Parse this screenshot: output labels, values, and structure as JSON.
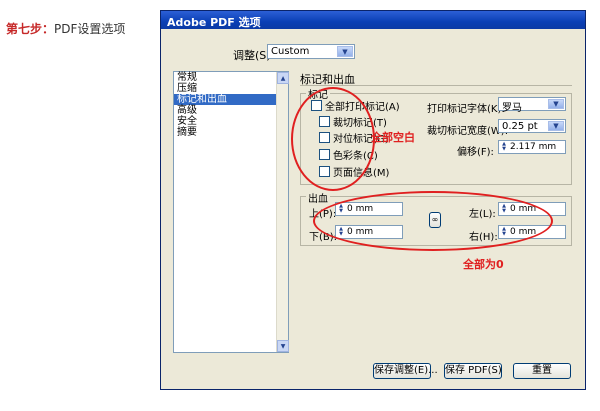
{
  "caption": {
    "step": "第七步：",
    "text": "PDF设置选项"
  },
  "window": {
    "title": "Adobe PDF 选项"
  },
  "preset": {
    "label": "调整(S):",
    "value": "Custom"
  },
  "sidebar": {
    "items": [
      {
        "label": "常规"
      },
      {
        "label": "压缩"
      },
      {
        "label": "标记和出血"
      },
      {
        "label": "高级"
      },
      {
        "label": "安全"
      },
      {
        "label": "摘要"
      }
    ]
  },
  "main": {
    "section_title": "标记和出血",
    "marks": {
      "title": "标记",
      "all_marks": "全部打印标记(A)",
      "crop_marks": "裁切标记(T)",
      "registration_marks": "对位标记(G)",
      "color_bars": "色彩条(C)",
      "page_info": "页面信息(M)",
      "font_label": "打印标记字体(K):",
      "font_value": "罗马",
      "weight_label": "裁切标记宽度(W):",
      "weight_value": "0.25 pt",
      "offset_label": "偏移(F):",
      "offset_value": "2.117 mm"
    },
    "bleed": {
      "title": "出血",
      "top_label": "上(P):",
      "top_value": "0 mm",
      "bottom_label": "下(B):",
      "bottom_value": "0 mm",
      "left_label": "左(L):",
      "left_value": "0 mm",
      "right_label": "右(H):",
      "right_value": "0 mm"
    }
  },
  "annotations": {
    "marks_note": "全部空白",
    "bleed_note": "全部为0"
  },
  "buttons": {
    "save_preset": "保存调整(E)...",
    "save_pdf": "保存 PDF(S)",
    "reset": "重置"
  },
  "colors": {
    "annotation": "#e02020",
    "title_bar": "#0a3fb5",
    "selection": "#316ac5"
  }
}
